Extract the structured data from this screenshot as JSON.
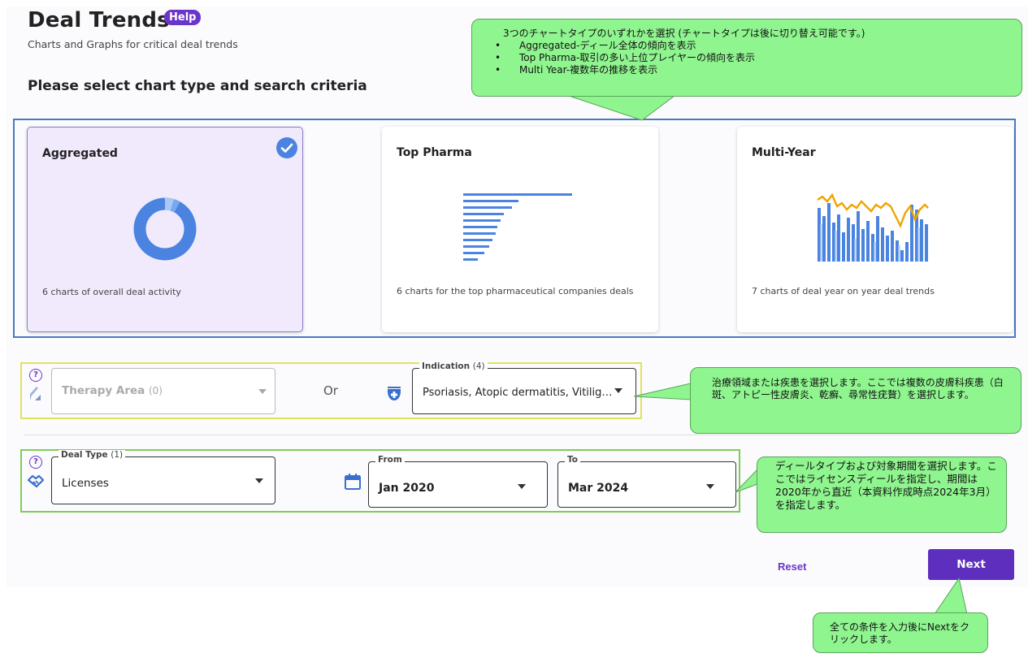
{
  "header": {
    "title": "Deal Trends",
    "help_label": "Help",
    "subtitle": "Charts and Graphs for critical deal trends",
    "section_heading": "Please select chart type and search criteria"
  },
  "chart_types": [
    {
      "title": "Aggregated",
      "desc": "6 charts of overall deal activity",
      "selected": true,
      "icon": "donut-chart-icon"
    },
    {
      "title": "Top Pharma",
      "desc": "6 charts for the top pharmaceutical companies deals",
      "selected": false,
      "icon": "horizontal-bar-chart-icon"
    },
    {
      "title": "Multi-Year",
      "desc": "7 charts of deal year on year deal trends",
      "selected": false,
      "icon": "bar-line-chart-icon"
    }
  ],
  "filters": {
    "therapy_area": {
      "label": "Therapy Area",
      "count": "(0)",
      "icon": "drop-icon"
    },
    "or_label": "Or",
    "indication": {
      "label": "Indication",
      "count": "(4)",
      "value": "Psoriasis, Atopic dermatitis, Vitilig…",
      "icon": "medicine-bowl-icon"
    },
    "deal_type": {
      "label": "Deal Type",
      "count": "(1)",
      "value": "Licenses",
      "icon": "handshake-icon"
    },
    "from": {
      "label": "From",
      "value": "Jan 2020"
    },
    "to": {
      "label": "To",
      "value": "Mar 2024"
    },
    "help_mark": "?"
  },
  "actions": {
    "reset_label": "Reset",
    "next_label": "Next"
  },
  "callouts": {
    "chart_type": {
      "intro": "3つのチャートタイプのいずれかを選択 (チャートタイプは後に切り替え可能です。)",
      "bullets": [
        "Aggregated-ディール全体の傾向を表示",
        "Top Pharma-取引の多い上位プレイヤーの傾向を表示",
        "Multi Year-複数年の推移を表示"
      ]
    },
    "indication": "治療領域または疾患を選択します。ここでは複数の皮膚科疾患（白斑、アトピー性皮膚炎、乾癬、尋常性疣贅）を選択します。",
    "deal": "ディールタイプおよび対象期間を選択します。ここではライセンスディールを指定し、期間は2020年から直近（本資料作成時点2024年3月）を指定します。",
    "next": "全ての条件を入力後にNextをクリックします。"
  },
  "colors": {
    "accent": "#5e2fbf",
    "chart_blue": "#4a84e0",
    "callout_green": "#8ff58f",
    "trend_line": "#f0a500"
  }
}
